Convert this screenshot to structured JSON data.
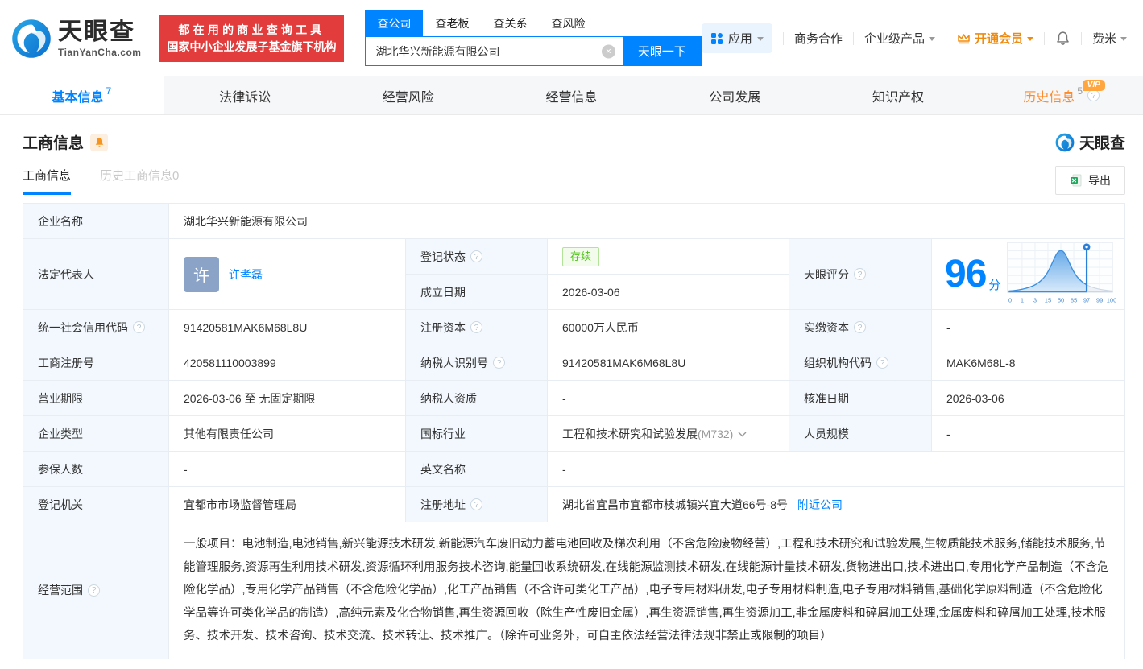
{
  "colors": {
    "accent_blue": "#0084ff",
    "banner_red": "#e23c3c",
    "vip_orange": "#ef8b0f",
    "status_green": "#52c41a"
  },
  "icons": {
    "help": "?",
    "clear": "×"
  },
  "header": {
    "logo_title": "天眼查",
    "logo_domain": "TianYanCha.com",
    "banner_line1": "都在用的商业查询工具",
    "banner_line2": "国家中小企业发展子基金旗下机构",
    "search_tabs": [
      "查公司",
      "查老板",
      "查关系",
      "查风险"
    ],
    "search_value": "湖北华兴新能源有限公司",
    "search_button": "天眼一下",
    "nav_apps": "应用",
    "nav_cooperation": "商务合作",
    "nav_enterprise": "企业级产品",
    "nav_vip": "开通会员",
    "nav_user": "费米"
  },
  "tabs": [
    {
      "label": "基本信息",
      "count": "7"
    },
    {
      "label": "法律诉讼"
    },
    {
      "label": "经营风险"
    },
    {
      "label": "经营信息"
    },
    {
      "label": "公司发展"
    },
    {
      "label": "知识产权"
    },
    {
      "label": "历史信息",
      "count": "5",
      "vip": "VIP"
    }
  ],
  "section": {
    "title": "工商信息",
    "watermark": "天眼查",
    "subtab_current": "工商信息",
    "subtab_history": "历史工商信息",
    "subtab_history_count": "0",
    "export_label": "导出"
  },
  "info": {
    "company_name": {
      "label": "企业名称",
      "value": "湖北华兴新能源有限公司"
    },
    "legal_rep": {
      "label": "法定代表人",
      "avatar": "许",
      "name": "许孝磊"
    },
    "reg_status": {
      "label": "登记状态",
      "value": "存续"
    },
    "establish_date": {
      "label": "成立日期",
      "value": "2026-03-06"
    },
    "score": {
      "label": "天眼评分",
      "value": "96",
      "unit": "分"
    },
    "credit_code": {
      "label": "统一社会信用代码",
      "value": "91420581MAK6M68L8U"
    },
    "reg_capital": {
      "label": "注册资本",
      "value": "60000万人民币"
    },
    "paid_capital": {
      "label": "实缴资本",
      "value": "-"
    },
    "reg_no": {
      "label": "工商注册号",
      "value": "420581110003899"
    },
    "taxpayer_no": {
      "label": "纳税人识别号",
      "value": "91420581MAK6M68L8U"
    },
    "org_code": {
      "label": "组织机构代码",
      "value": "MAK6M68L-8"
    },
    "term": {
      "label": "营业期限",
      "value": "2026-03-06 至 无固定期限"
    },
    "taxpayer_quality": {
      "label": "纳税人资质",
      "value": "-"
    },
    "approve_date": {
      "label": "核准日期",
      "value": "2026-03-06"
    },
    "company_type": {
      "label": "企业类型",
      "value": "其他有限责任公司"
    },
    "industry": {
      "label": "国标行业",
      "value": "工程和技术研究和试验发展",
      "code": "(M732)"
    },
    "staff_size": {
      "label": "人员规模",
      "value": "-"
    },
    "insured_num": {
      "label": "参保人数",
      "value": "-"
    },
    "english_name": {
      "label": "英文名称",
      "value": "-"
    },
    "reg_org": {
      "label": "登记机关",
      "value": "宜都市市场监督管理局"
    },
    "address": {
      "label": "注册地址",
      "value": "湖北省宜昌市宜都市枝城镇兴宜大道66号-8号",
      "link": "附近公司"
    },
    "scope": {
      "label": "经营范围",
      "value": "一般项目：电池制造,电池销售,新兴能源技术研发,新能源汽车废旧动力蓄电池回收及梯次利用（不含危险废物经营）,工程和技术研究和试验发展,生物质能技术服务,储能技术服务,节能管理服务,资源再生利用技术研发,资源循环利用服务技术咨询,能量回收系统研发,在线能源监测技术研发,在线能源计量技术研发,货物进出口,技术进出口,专用化学产品制造（不含危险化学品）,专用化学产品销售（不含危险化学品）,化工产品销售（不含许可类化工产品）,电子专用材料研发,电子专用材料制造,电子专用材料销售,基础化学原料制造（不含危险化学品等许可类化学品的制造）,高纯元素及化合物销售,再生资源回收（除生产性废旧金属）,再生资源销售,再生资源加工,非金属废料和碎屑加工处理,金属废料和碎屑加工处理,技术服务、技术开发、技术咨询、技术交流、技术转让、技术推广。（除许可业务外，可自主依法经营法律法规非禁止或限制的项目）"
    }
  },
  "chart_data": {
    "type": "area",
    "title": "天眼评分",
    "score": 96,
    "unit": "分",
    "x_ticks": [
      "0",
      "1",
      "3",
      "15",
      "50",
      "85",
      "97",
      "99",
      "100"
    ],
    "marker_tick": "97",
    "peak_tick": "50",
    "grid": true
  }
}
